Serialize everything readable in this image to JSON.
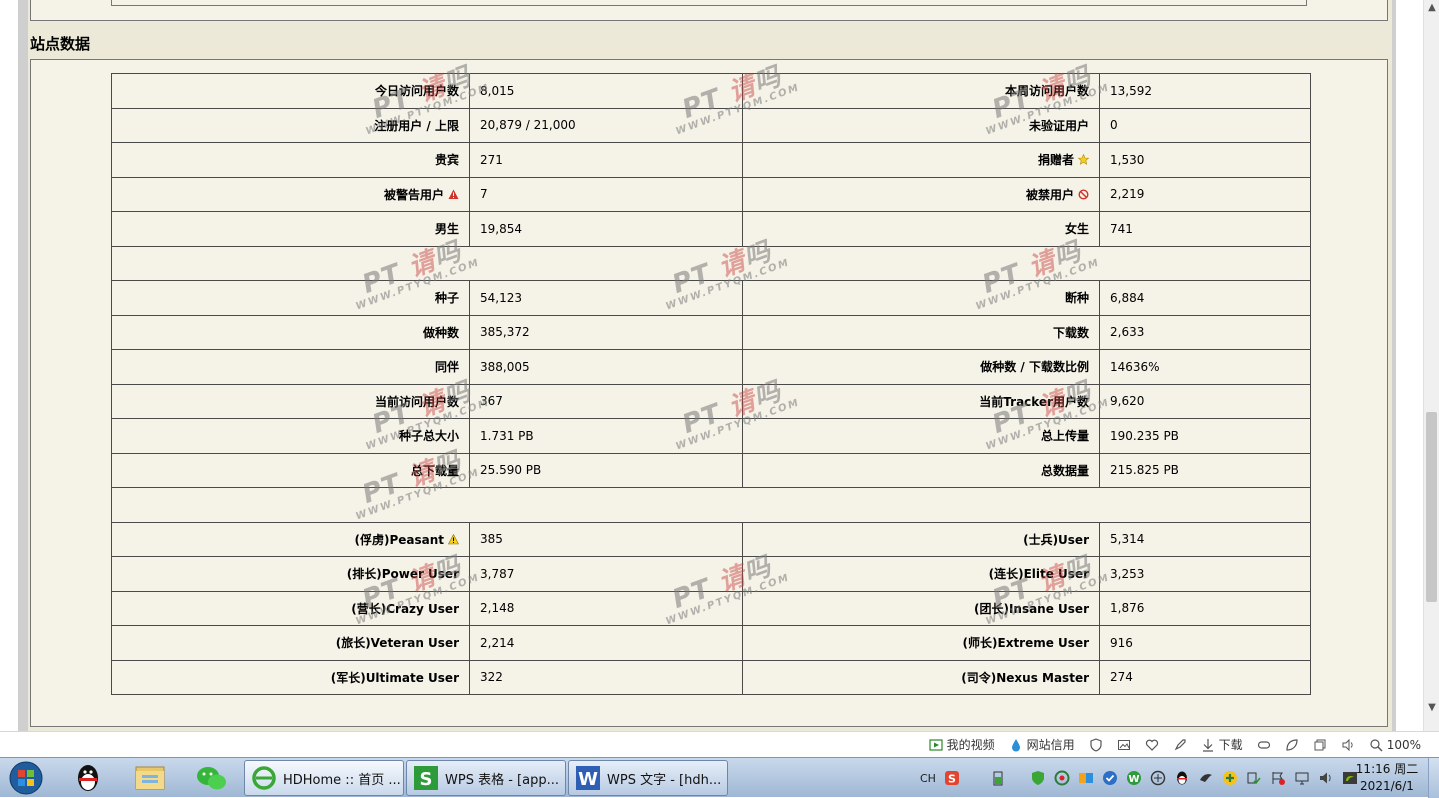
{
  "section": {
    "title": "站点数据"
  },
  "stats": {
    "rows": [
      {
        "l_label": "今日访问用户数",
        "l_value": "8,015",
        "r_label": "本周访问用户数",
        "r_value": "13,592"
      },
      {
        "l_label": "注册用户 / 上限",
        "l_value": "20,879 / 21,000",
        "r_label": "未验证用户",
        "r_value": "0"
      },
      {
        "l_label": "贵宾",
        "l_value": "271",
        "r_label": "捐赠者",
        "r_value": "1,530",
        "r_icon": "star-icon"
      },
      {
        "l_label": "被警告用户",
        "l_value": "7",
        "l_icon": "warning-red-icon",
        "r_label": "被禁用户",
        "r_value": "2,219",
        "r_icon": "banned-icon"
      },
      {
        "l_label": "男生",
        "l_value": "19,854",
        "r_label": "女生",
        "r_value": "741"
      },
      {
        "spacer": true
      },
      {
        "l_label": "种子",
        "l_value": "54,123",
        "r_label": "断种",
        "r_value": "6,884"
      },
      {
        "l_label": "做种数",
        "l_value": "385,372",
        "r_label": "下载数",
        "r_value": "2,633"
      },
      {
        "l_label": "同伴",
        "l_value": "388,005",
        "r_label": "做种数 / 下载数比例",
        "r_value": "14636%"
      },
      {
        "l_label": "当前访问用户数",
        "l_value": "367",
        "r_label": "当前Tracker用户数",
        "r_value": "9,620"
      },
      {
        "l_label": "种子总大小",
        "l_value": "1.731 PB",
        "r_label": "总上传量",
        "r_value": "190.235 PB"
      },
      {
        "l_label": "总下载量",
        "l_value": "25.590 PB",
        "r_label": "总数据量",
        "r_value": "215.825 PB"
      },
      {
        "spacer": true
      },
      {
        "l_label": "(俘虏)Peasant",
        "l_value": "385",
        "l_icon": "warning-yellow-icon",
        "r_label": "(士兵)User",
        "r_value": "5,314"
      },
      {
        "l_label": "(排长)Power User",
        "l_value": "3,787",
        "r_label": "(连长)Elite User",
        "r_value": "3,253"
      },
      {
        "l_label": "(营长)Crazy User",
        "l_value": "2,148",
        "r_label": "(团长)Insane User",
        "r_value": "1,876"
      },
      {
        "l_label": "(旅长)Veteran User",
        "l_value": "2,214",
        "r_label": "(师长)Extreme User",
        "r_value": "916"
      },
      {
        "l_label": "(军长)Ultimate User",
        "l_value": "322",
        "r_label": "(司令)Nexus Master",
        "r_value": "274"
      }
    ]
  },
  "watermark": {
    "pt": "PT",
    "qing": "请",
    "ma": "吗",
    "url": "WWW.PTYQM.COM"
  },
  "statusbar": {
    "my_video": "我的视频",
    "site_credit": "网站信用",
    "download": "下载",
    "zoom": "100%"
  },
  "taskbar": {
    "tasks": [
      {
        "label": "HDHome :: 首页 ...",
        "icon": "ie-browser-icon",
        "color": "#3aa635"
      },
      {
        "label": "WPS 表格 - [app...",
        "icon": "wps-spreadsheet-icon",
        "color": "#2e9b3a"
      },
      {
        "label": "WPS 文字 - [hdh...",
        "icon": "wps-writer-icon",
        "color": "#2f5fb5"
      }
    ],
    "ime": "CH",
    "clock_time": "11:16 周二",
    "clock_date": "2021/6/1"
  },
  "colors": {
    "page_bg": "#ece9d8",
    "table_bg": "#f5f3e8",
    "border": "#4a4a4a",
    "taskbar": "#b4c8e1"
  }
}
